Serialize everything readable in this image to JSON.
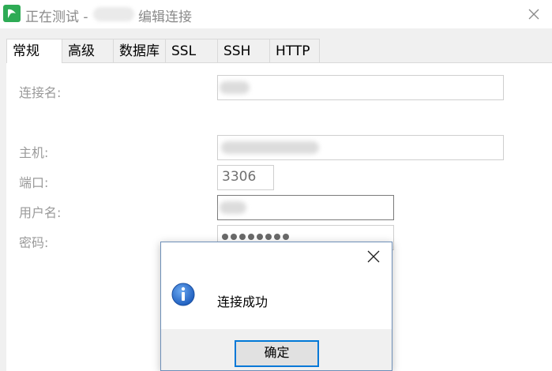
{
  "window": {
    "title_prefix": "正在测试 -",
    "title_suffix": "编辑连接"
  },
  "tabs": [
    {
      "label": "常规",
      "active": true
    },
    {
      "label": "高级",
      "active": false
    },
    {
      "label": "数据库",
      "active": false
    },
    {
      "label": "SSL",
      "active": false
    },
    {
      "label": "SSH",
      "active": false
    },
    {
      "label": "HTTP",
      "active": false
    }
  ],
  "form": {
    "connection_name": {
      "label": "连接名:"
    },
    "host": {
      "label": "主机:"
    },
    "port": {
      "label": "端口:",
      "value": "3306"
    },
    "username": {
      "label": "用户名:"
    },
    "password": {
      "label": "密码:",
      "masked_count": 8
    }
  },
  "message_box": {
    "icon": "info-icon",
    "text": "连接成功",
    "ok_label": "确定"
  },
  "colors": {
    "app_icon": "#2eab55",
    "focus_border": "#0078d7",
    "info_icon": "#1f5fbf"
  }
}
